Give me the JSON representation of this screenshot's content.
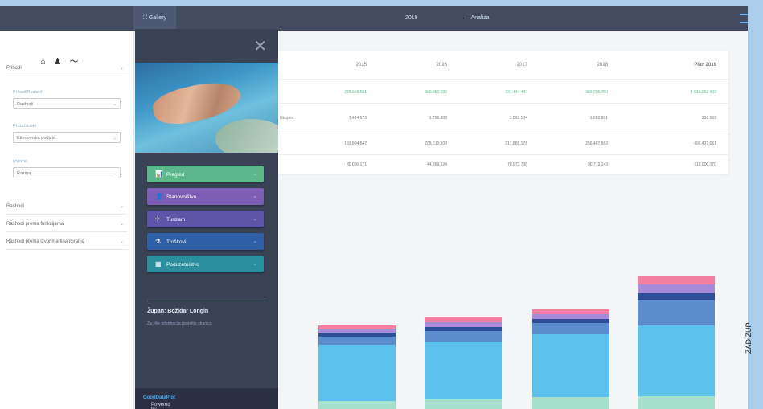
{
  "topbar": {
    "tabs": [
      {
        "label": "Gallery",
        "active": true
      },
      {
        "label": "2019",
        "active": false
      },
      {
        "label": "— Analiza",
        "active": false
      }
    ]
  },
  "sidebar": {
    "icons": [
      "home-icon",
      "user-icon",
      "chart-icon"
    ],
    "rows_top": [
      {
        "label": "Prihodi"
      }
    ],
    "fields": [
      {
        "label": "Prihod/Rashod",
        "value": "Rashodi"
      },
      {
        "label": "Proračunski",
        "value": "Ekonomska podjela"
      },
      {
        "label": "Izvorno",
        "value": "Razina"
      }
    ],
    "rows_bottom": [
      {
        "label": "Rashodi"
      },
      {
        "label": "Rashodi prema funkcijama"
      },
      {
        "label": "Rashodi prema izvorima financiranja"
      }
    ]
  },
  "panel": {
    "categories": [
      {
        "label": "Pregled",
        "icon": "📊",
        "color": "#5cb88a"
      },
      {
        "label": "Stanovništvo",
        "icon": "👤",
        "color": "#7c5fb5"
      },
      {
        "label": "Turizam",
        "icon": "✈",
        "color": "#5e55a8"
      },
      {
        "label": "Troškovi",
        "icon": "⚗",
        "color": "#2f5fa6"
      },
      {
        "label": "Poduzetništvo",
        "icon": "▦",
        "color": "#2a8e9c"
      }
    ],
    "title": "Župan: Božidar Longin",
    "subtitle": "Za više informacija posjetite stranicu",
    "footer_prefix": "Powered by",
    "footer_brand": "GoodDataPlot"
  },
  "table": {
    "headers": [
      "2015",
      "2016",
      "2017",
      "2018",
      "Plan 2019"
    ],
    "rows": [
      {
        "label": "",
        "values": [
          "275.903.591",
          "300.882.180",
          "331.444.440",
          "365.206.750",
          "1.018.252.400"
        ],
        "highlight": true
      },
      {
        "label": "Ukupno",
        "values": [
          "1.424.673",
          "1.756.803",
          "1.053.504",
          "1.082.881",
          "310.562"
        ],
        "highlight": false
      },
      {
        "label": "",
        "values": [
          "193.904.847",
          "208.510.300",
          "217.865.178",
          "256.487.663",
          "406.421.061"
        ],
        "highlight": false
      },
      {
        "label": "",
        "values": [
          "80.000.171",
          "44.869.824",
          "78.973.736",
          "90.719.143",
          "313.900.170"
        ],
        "highlight": false
      }
    ]
  },
  "chart_data": {
    "type": "bar",
    "stacked": true,
    "categories": [
      "",
      "",
      "",
      ""
    ],
    "colors": [
      "#a6e0cd",
      "#5ec0ec",
      "#5b8ccd",
      "#2f4e9a",
      "#a78bd8",
      "#f47fa3"
    ],
    "series": [
      {
        "values": [
          10,
          12,
          15,
          16
        ]
      },
      {
        "values": [
          70,
          72,
          78,
          88
        ]
      },
      {
        "values": [
          10,
          13,
          14,
          32
        ]
      },
      {
        "values": [
          4,
          5,
          5,
          8
        ]
      },
      {
        "values": [
          5,
          6,
          6,
          11
        ]
      },
      {
        "values": [
          5,
          7,
          6,
          10
        ]
      }
    ],
    "ylim": [
      0,
      180
    ],
    "grid": false,
    "legend": "none"
  },
  "side_caption": "ZAD ŽUP"
}
